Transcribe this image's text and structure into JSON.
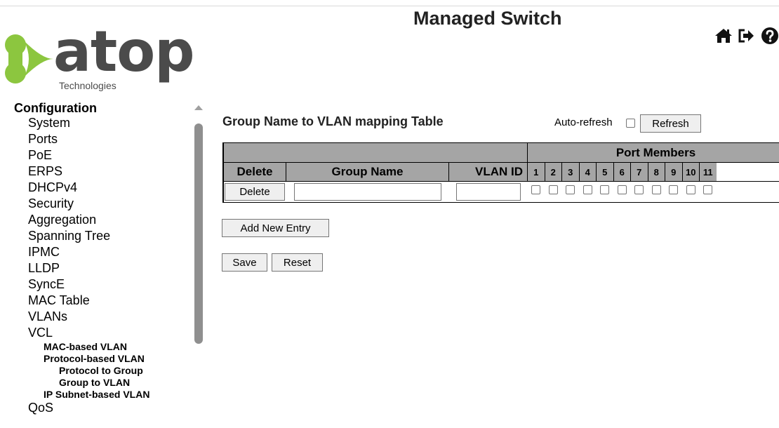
{
  "header": {
    "brand_word": "atop",
    "brand_sub": "Technologies",
    "app_title": "Managed Switch",
    "icons": [
      "home-icon",
      "logout-icon",
      "help-icon"
    ]
  },
  "sidebar": {
    "heading": "Configuration",
    "items": [
      "System",
      "Ports",
      "PoE",
      "ERPS",
      "DHCPv4",
      "Security",
      "Aggregation",
      "Spanning Tree",
      "IPMC",
      "LLDP",
      "SyncE",
      "MAC Table",
      "VLANs",
      "VCL"
    ],
    "vcl_children": {
      "mac_based": "MAC-based VLAN",
      "protocol_based": "Protocol-based VLAN",
      "protocol_to_group": "Protocol to Group",
      "group_to_vlan": "Group to VLAN",
      "ip_subnet_based": "IP Subnet-based VLAN"
    },
    "after": "QoS"
  },
  "main": {
    "title": "Group Name to VLAN mapping Table",
    "auto_refresh_label": "Auto-refresh",
    "auto_refresh_checked": false,
    "refresh_label": "Refresh",
    "table": {
      "port_members_header": "Port Members",
      "col_delete": "Delete",
      "col_group_name": "Group Name",
      "col_vlan_id": "VLAN ID",
      "ports": [
        "1",
        "2",
        "3",
        "4",
        "5",
        "6",
        "7",
        "8",
        "9",
        "10",
        "11"
      ],
      "rows": [
        {
          "delete_label": "Delete",
          "group_name": "",
          "vlan_id": "",
          "port_checked": [
            false,
            false,
            false,
            false,
            false,
            false,
            false,
            false,
            false,
            false,
            false
          ]
        }
      ]
    },
    "add_entry_label": "Add New Entry",
    "save_label": "Save",
    "reset_label": "Reset"
  },
  "colors": {
    "table_header_bg": "#a5a5a5",
    "logo_green": "#8cc63f",
    "logo_text": "#4b4b4b"
  }
}
